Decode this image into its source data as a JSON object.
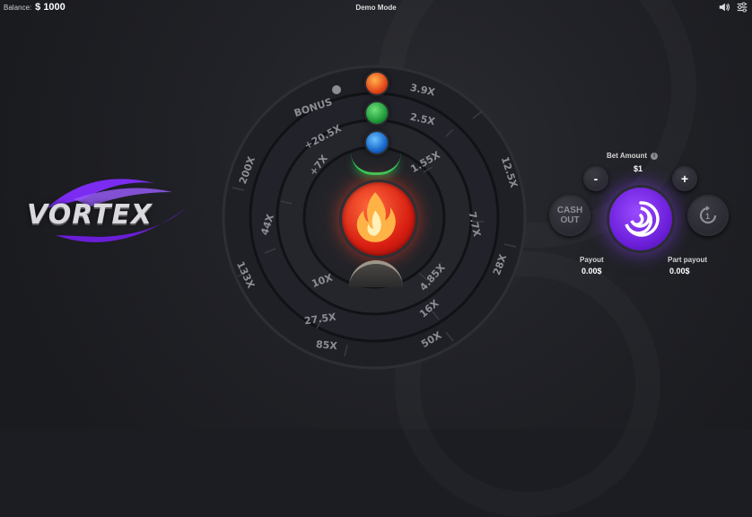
{
  "topbar": {
    "balance_label": "Balance:",
    "balance_value": "$ 1000",
    "mode": "Demo Mode"
  },
  "logo": {
    "text": "VORTEX",
    "accent_color": "#7b2cf0"
  },
  "wheel": {
    "bonus_label": "BONUS",
    "outer_ring": [
      "3.9X",
      "12.5X",
      "28X",
      "50X",
      "85X",
      "133X",
      "200X"
    ],
    "ring2": [
      "2.5X",
      "7.7X",
      "16X",
      "27.5X",
      "44X",
      "+20.5X"
    ],
    "ring3": [
      "1.55X",
      "4.85X",
      "10X",
      "+7X"
    ]
  },
  "panel": {
    "bet_label": "Bet Amount",
    "bet_value": "$1",
    "minus": "-",
    "plus": "+",
    "cashout_line1": "CASH",
    "cashout_line2": "OUT",
    "autoplay_count": "1",
    "payout_label": "Payout",
    "payout_value": "0.00$",
    "part_payout_label": "Part payout",
    "part_payout_value": "0.00$"
  },
  "colors": {
    "background": "#1c1d22",
    "spin": "#7b2cf0",
    "fire": "#e3461a",
    "leaf": "#1f9a3a",
    "water": "#1765c9"
  }
}
